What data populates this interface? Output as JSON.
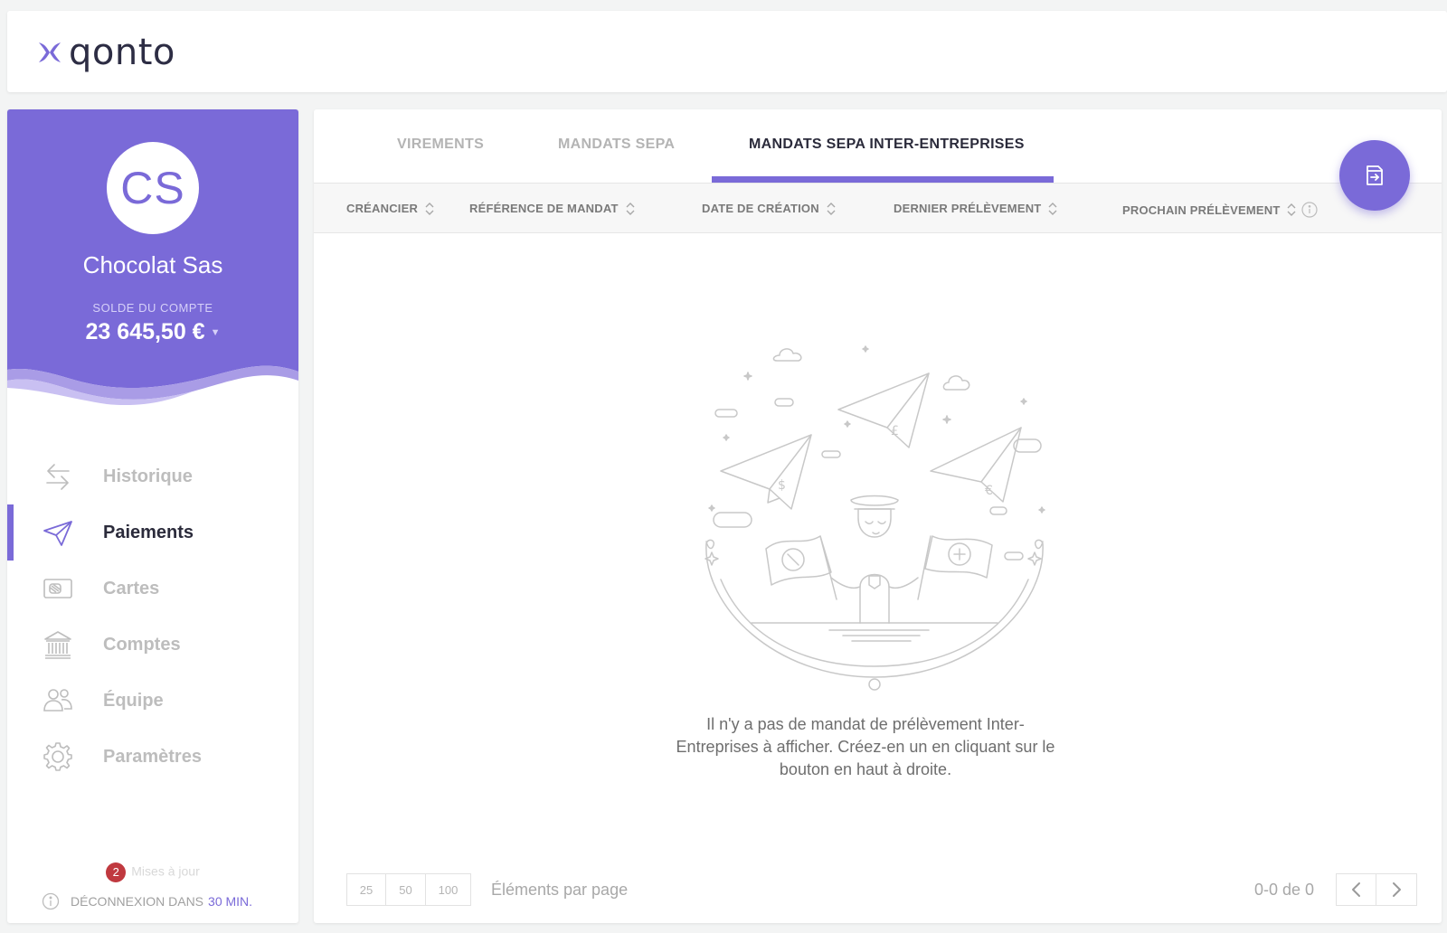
{
  "brand": {
    "name": "qonto",
    "accent": "#7a6ad8"
  },
  "sidebar": {
    "avatar_initials": "CS",
    "company_name": "Chocolat Sas",
    "balance_label": "SOLDE DU COMPTE",
    "balance": "23 645,50 €",
    "items": [
      {
        "label": "Historique",
        "icon": "transfer-arrows-icon",
        "active": false
      },
      {
        "label": "Paiements",
        "icon": "paper-plane-icon",
        "active": true
      },
      {
        "label": "Cartes",
        "icon": "card-icon",
        "active": false
      },
      {
        "label": "Comptes",
        "icon": "bank-icon",
        "active": false
      },
      {
        "label": "Équipe",
        "icon": "team-icon",
        "active": false
      },
      {
        "label": "Paramètres",
        "icon": "gear-icon",
        "active": false
      }
    ],
    "updates_count": "2",
    "updates_label": "Mises à jour",
    "logout_label": "DÉCONNEXION DANS",
    "logout_time": "30 MIN."
  },
  "tabs": [
    {
      "label": "VIREMENTS",
      "active": false
    },
    {
      "label": "MANDATS SEPA",
      "active": false
    },
    {
      "label": "MANDATS SEPA INTER-ENTREPRISES",
      "active": true
    }
  ],
  "columns": [
    "CRÉANCIER",
    "RÉFÉRENCE DE MANDAT",
    "DATE DE CRÉATION",
    "DERNIER PRÉLÈVEMENT",
    "PROCHAIN PRÉLÈVEMENT"
  ],
  "empty_message": "Il n'y a pas de mandat de prélèvement Inter-Entreprises à afficher. Créez-en un en cliquant sur le bouton en haut à droite.",
  "pagination": {
    "per_page_options": [
      "25",
      "50",
      "100"
    ],
    "per_page_label": "Éléments par page",
    "range": "0-0 de 0"
  }
}
